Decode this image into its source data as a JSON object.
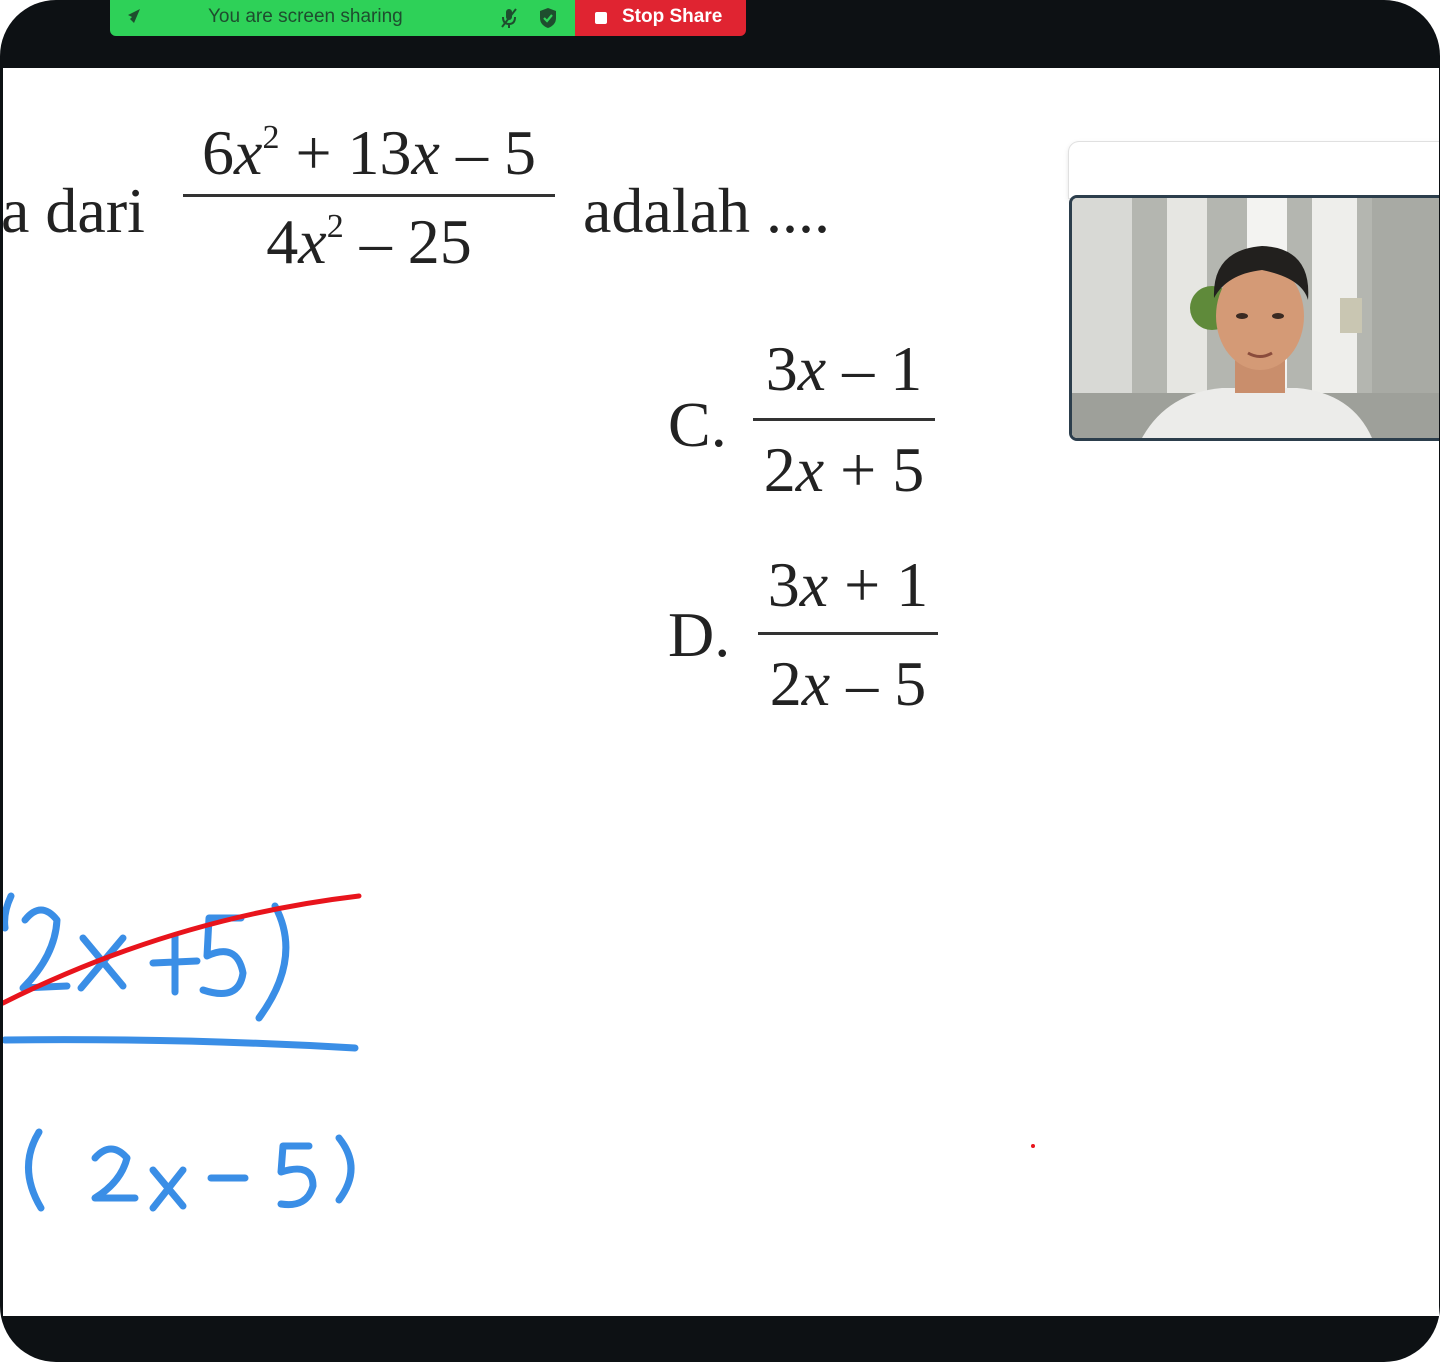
{
  "share_bar": {
    "status_text": "You are screen sharing",
    "stop_label": "Stop Share",
    "colors": {
      "share": "#2ed158",
      "stop": "#e02431"
    }
  },
  "question": {
    "prefix": "a dari",
    "numerator": [
      "6",
      "x",
      "2",
      " + 13",
      "x",
      " – 5"
    ],
    "denominator": [
      "4",
      "x",
      "2",
      " – 25"
    ],
    "suffix": "adalah ...."
  },
  "options": [
    {
      "letter": "C.",
      "num": [
        "3",
        "x",
        " – 1"
      ],
      "den": [
        "2",
        "x",
        " + 5"
      ]
    },
    {
      "letter": "D.",
      "num": [
        "3",
        "x",
        " + 1"
      ],
      "den": [
        "2",
        "x",
        " – 5"
      ]
    }
  ],
  "handwriting": {
    "top": "(2x+5)",
    "bottom": "(2x-5)",
    "ink_color": "#3a8ee6",
    "strike_color": "#e8141c"
  },
  "video": {
    "participant_icon": "person-video-icon"
  }
}
